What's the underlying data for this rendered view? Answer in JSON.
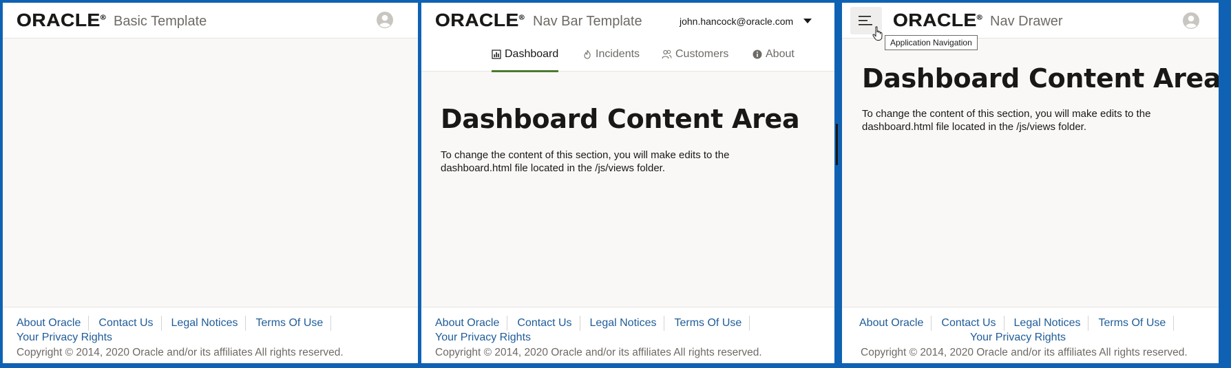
{
  "brand": {
    "logo_text": "ORACLE",
    "registered_mark": "®"
  },
  "panels": {
    "basic": {
      "app_title": "Basic Template",
      "avatar_icon": "user-avatar-icon"
    },
    "navbar": {
      "app_title": "Nav Bar Template",
      "user_email": "john.hancock@oracle.com",
      "tabs": [
        {
          "label": "Dashboard",
          "icon": "chart-icon",
          "selected": true
        },
        {
          "label": "Incidents",
          "icon": "fire-icon",
          "selected": false
        },
        {
          "label": "Customers",
          "icon": "people-icon",
          "selected": false
        },
        {
          "label": "About",
          "icon": "info-icon",
          "selected": false
        }
      ],
      "content_title": "Dashboard Content Area",
      "content_body": "To change the content of this section, you will make edits to the dashboard.html file located in the /js/views folder."
    },
    "drawer": {
      "app_title": "Nav Drawer",
      "tooltip": "Application Navigation",
      "content_title": "Dashboard Content Area",
      "content_body": "To change the content of this section, you will make edits to the dashboard.html file located in the /js/views folder."
    }
  },
  "footer": {
    "links": [
      "About Oracle",
      "Contact Us",
      "Legal Notices",
      "Terms Of Use"
    ],
    "privacy": "Your Privacy Rights",
    "copyright": "Copyright © 2014, 2020 Oracle and/or its affiliates All rights reserved."
  },
  "colors": {
    "frame": "#0f62b3",
    "link": "#1f5c99",
    "tab_selected_underline": "#4b7a2f",
    "background": "#f9f8f6"
  }
}
